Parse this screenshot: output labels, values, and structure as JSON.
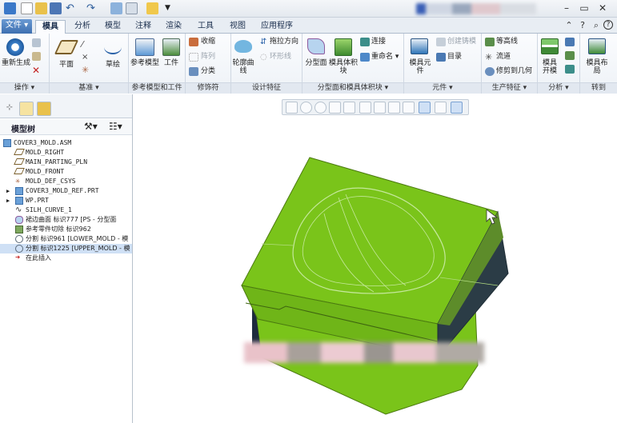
{
  "tabs": [
    {
      "label": "文件",
      "kind": "file"
    },
    {
      "label": "模具",
      "kind": "active"
    },
    {
      "label": "分析",
      "kind": ""
    },
    {
      "label": "模型",
      "kind": ""
    },
    {
      "label": "注释",
      "kind": ""
    },
    {
      "label": "渲染",
      "kind": ""
    },
    {
      "label": "工具",
      "kind": ""
    },
    {
      "label": "视图",
      "kind": ""
    },
    {
      "label": "应用程序",
      "kind": ""
    }
  ],
  "ribbon": {
    "groups": {
      "operations": "操作",
      "datum": "基准",
      "ref_model_workpiece": "参考模型和工件",
      "modifiers": "修饰符",
      "design_features": "设计特征",
      "parting_mold_volume": "分型面和模具体积块",
      "components": "元件",
      "production_features": "生产特征",
      "analysis": "分析",
      "goto": "转到"
    },
    "regenerate": "重新生成",
    "plane": "平面",
    "sketch": "草绘",
    "ref_model": "参考模型",
    "workpiece": "工件",
    "shrink": "收缩",
    "pattern": "阵列",
    "classify": "分类",
    "drag_direction": "拖拉方向",
    "silhouette": "轮廓曲线",
    "skirt": "环形线",
    "parting_surface": "分型面",
    "mold_volume": "模具体积块",
    "split": "连接",
    "rename": "重命名",
    "mold_component": "模具元件",
    "create_casting": "创建铸模",
    "catalog": "目录",
    "waterline": "等高线",
    "runner": "流道",
    "trim_geometry": "修剪到几何",
    "mold_open": "模具开模",
    "mold_layout": "模具布局"
  },
  "model_tree": {
    "title": "模型树",
    "items": [
      {
        "text": "COVER3_MOLD.ASM",
        "indent": 0
      },
      {
        "text": "MOLD_RIGHT",
        "indent": 1
      },
      {
        "text": "MAIN_PARTING_PLN",
        "indent": 1
      },
      {
        "text": "MOLD_FRONT",
        "indent": 1
      },
      {
        "text": "MOLD_DEF_CSYS",
        "indent": 1
      },
      {
        "text": "COVER3_MOLD_REF.PRT",
        "indent": 1
      },
      {
        "text": "WP.PRT",
        "indent": 1
      },
      {
        "text": "SILH_CURVE_1",
        "indent": 1
      },
      {
        "text": "裙边曲面 标识777 [PS - 分型面",
        "indent": 1
      },
      {
        "text": "参考零件切除 标识962",
        "indent": 1
      },
      {
        "text": "分割 标识961 [LOWER_MOLD - 模",
        "indent": 1
      },
      {
        "text": "分割 标识1225 [UPPER_MOLD - 模",
        "indent": 1
      },
      {
        "text": "在此插入",
        "indent": 1
      }
    ]
  },
  "colors": {
    "mold_green": "#7ac41a",
    "accent_blue": "#3d6fb0"
  }
}
